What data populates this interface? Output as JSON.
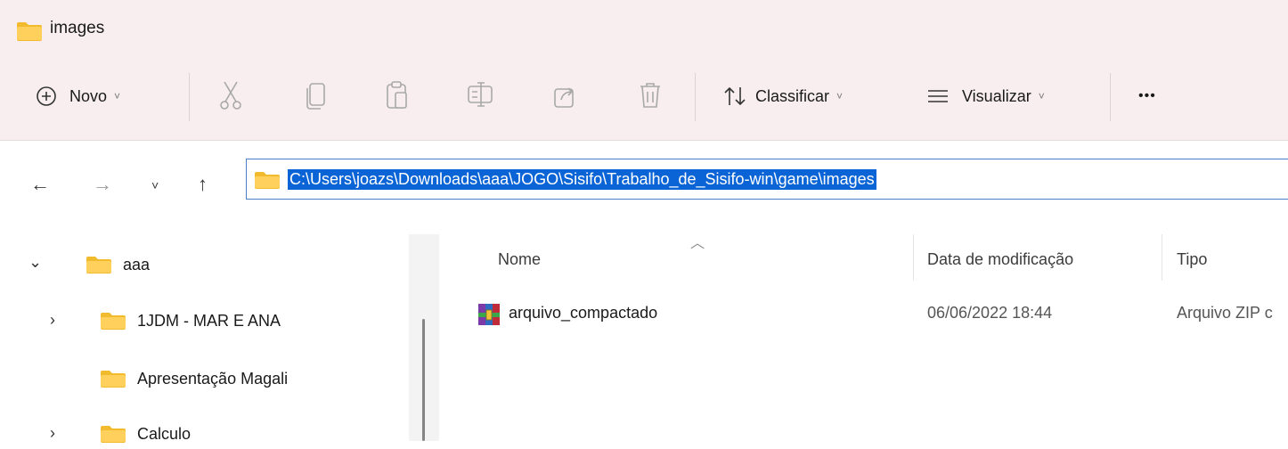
{
  "window": {
    "title": "images"
  },
  "toolbar": {
    "new_label": "Novo",
    "sort_label": "Classificar",
    "view_label": "Visualizar",
    "more_label": "•••"
  },
  "address": {
    "path": "C:\\Users\\joazs\\Downloads\\aaa\\JOGO\\Sisifo\\Trabalho_de_Sisifo-win\\game\\images"
  },
  "tree": [
    {
      "label": "aaa",
      "expanded": true
    },
    {
      "label": "1JDM - MAR E ANA",
      "expanded": false
    },
    {
      "label": "Apresentação Magali"
    },
    {
      "label": "Calculo",
      "expanded": false
    }
  ],
  "columns": {
    "name": "Nome",
    "modified": "Data de modificação",
    "type": "Tipo"
  },
  "files": [
    {
      "name": "arquivo_compactado",
      "modified": "06/06/2022 18:44",
      "type": "Arquivo ZIP c"
    }
  ],
  "colors": {
    "accent": "#0a64d6",
    "titlebar": "#f8eef0",
    "folder": "#f2bb2d"
  }
}
